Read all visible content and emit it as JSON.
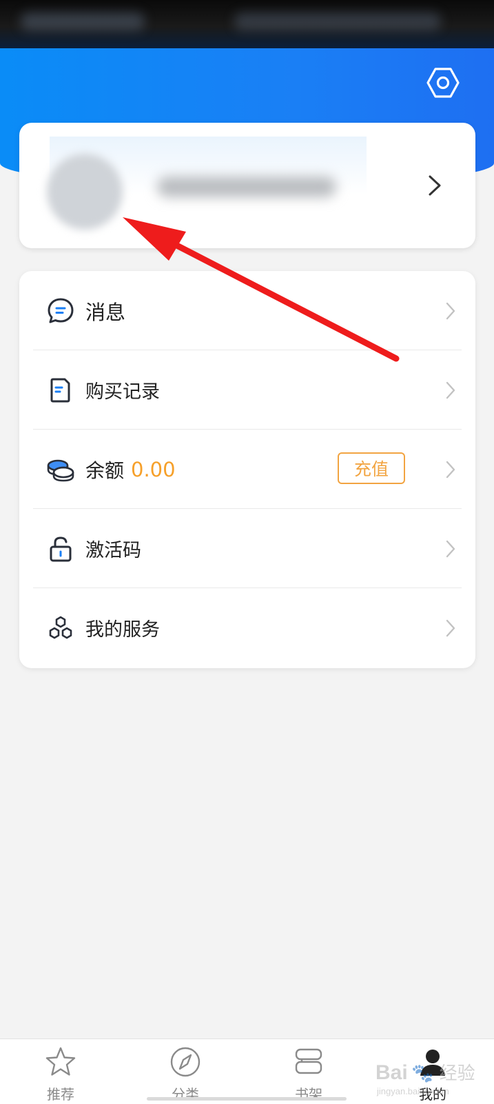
{
  "menu": {
    "items": [
      {
        "label": "消息",
        "icon": "message-icon"
      },
      {
        "label": "购买记录",
        "icon": "purchase-record-icon"
      },
      {
        "label": "余额",
        "icon": "coins-icon",
        "value": "0.00",
        "action": "充值"
      },
      {
        "label": "激活码",
        "icon": "unlock-icon"
      },
      {
        "label": "我的服务",
        "icon": "services-icon"
      }
    ]
  },
  "bottom_nav": {
    "items": [
      {
        "label": "推荐",
        "icon": "star-icon"
      },
      {
        "label": "分类",
        "icon": "compass-icon"
      },
      {
        "label": "书架",
        "icon": "bookshelf-icon"
      },
      {
        "label": "我的",
        "icon": "user-icon",
        "active": true
      }
    ]
  },
  "watermark": {
    "text": "Bai 经验",
    "sub": "jingyan.baidu.com"
  },
  "colors": {
    "header_blue": "#1a7ff5",
    "accent_orange": "#f6a02a",
    "annotation_red": "#ee1c1c"
  }
}
